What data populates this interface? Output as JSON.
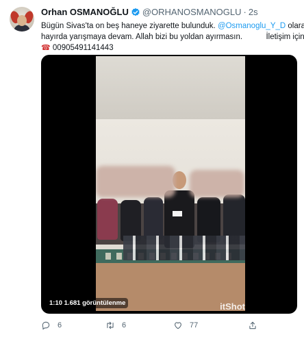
{
  "tweet": {
    "author_name": "Orhan OSMANOĞLU",
    "handle": "@ORHANOSMANOGLU",
    "separator": "·",
    "time": "2s",
    "text": {
      "line1": "Bügün Sivas'ta on beş haneye ziyarette bulunduk.",
      "mention": "@Osmanoglu_Y_D",
      "line1_end": "olarak",
      "line2_start": "hayırda yarışmaya devam. Allah bizi bu yoldan ayırmasın.",
      "line2_end": "İletişim için",
      "phone": "00905491141443"
    }
  },
  "media": {
    "overlay_text": "1:10  1.681 görüntülenme",
    "watermark": "itShot"
  },
  "actions": {
    "reply_count": "6",
    "retweet_count": "6",
    "like_count": "77"
  },
  "colors": {
    "link": "#1d9bf0",
    "secondary": "#536471",
    "text": "#0f1419"
  },
  "icons": {
    "verified": "verified-icon",
    "reply": "reply-icon",
    "retweet": "retweet-icon",
    "like": "heart-icon",
    "share": "share-icon",
    "phone": "telephone-icon"
  }
}
